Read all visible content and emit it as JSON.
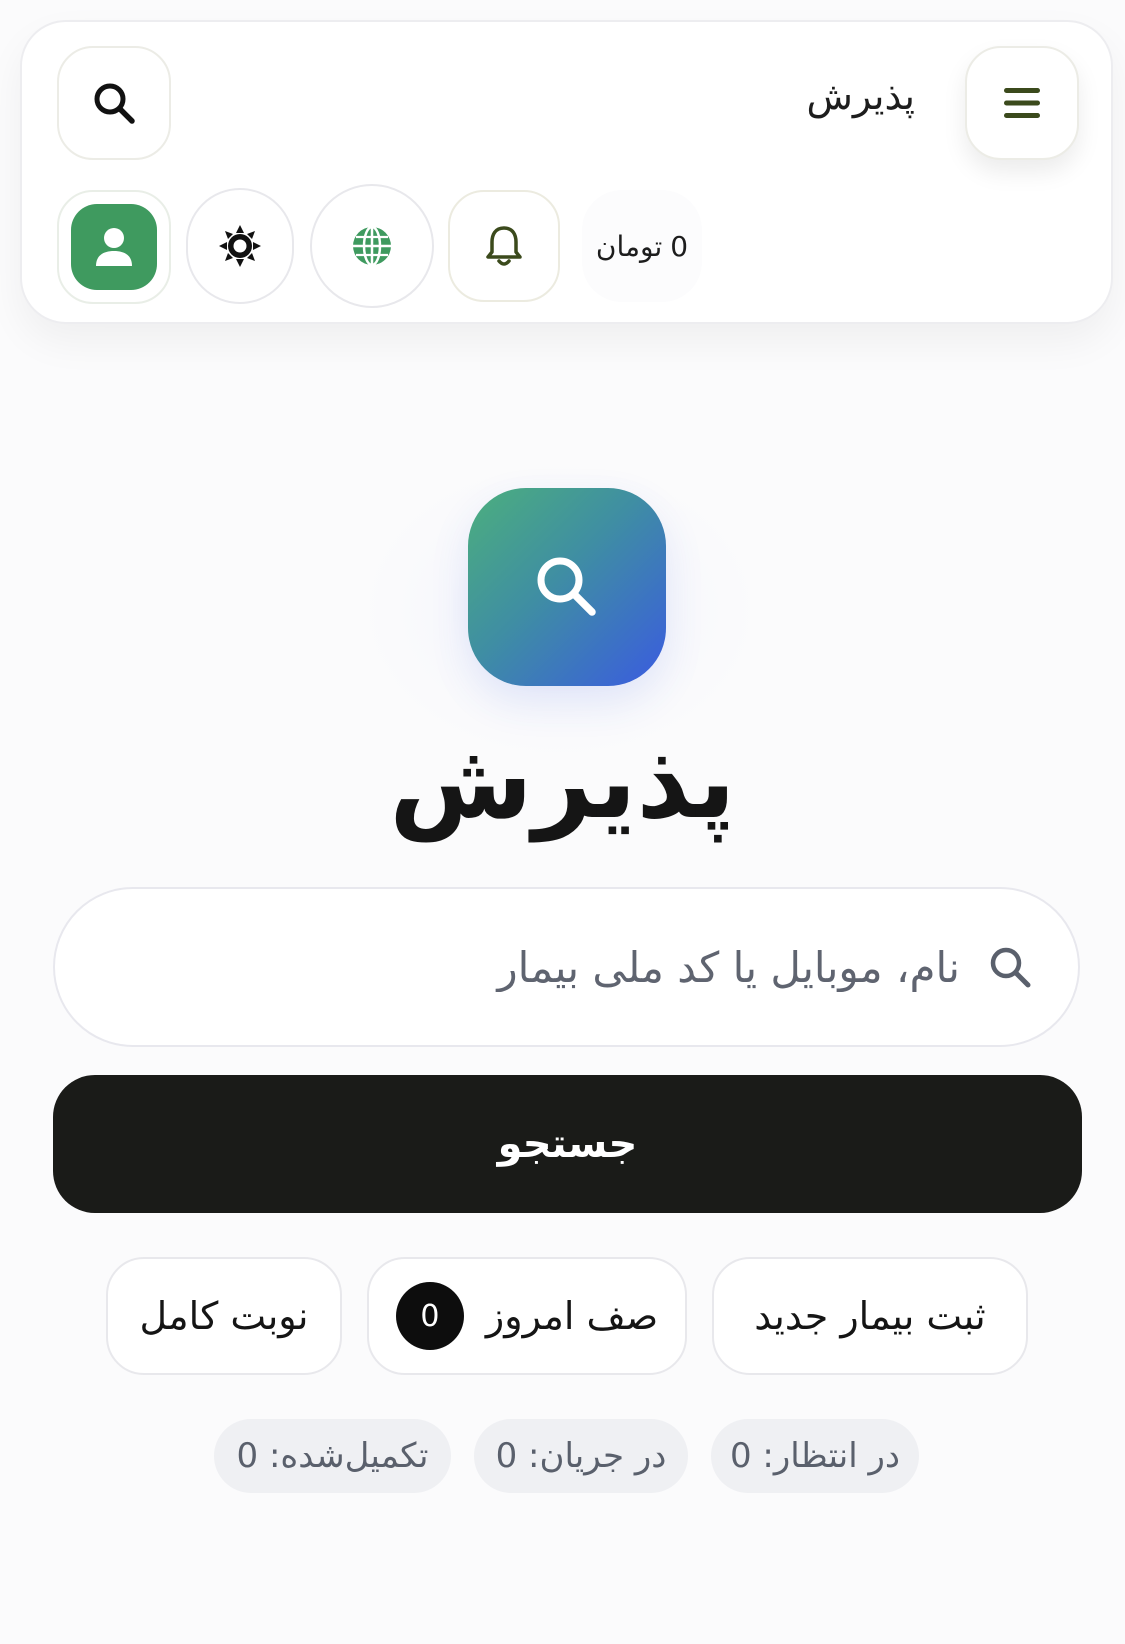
{
  "header": {
    "title": "پذیرش",
    "balance": {
      "amount": "0",
      "currency": "تومان"
    },
    "icons": {
      "menu": "hamburger-icon",
      "search": "search-icon",
      "notifications": "bell-icon",
      "language": "globe-icon",
      "theme": "sun-icon",
      "profile": "user-icon"
    }
  },
  "hero": {
    "title": "پذیرش",
    "icon": "search-icon"
  },
  "search": {
    "placeholder": "نام، موبایل یا کد ملی بیمار",
    "value": "",
    "submit_label": "جستجو"
  },
  "actions": {
    "new_patient": "ثبت بیمار جدید",
    "today_queue": "صف امروز",
    "today_queue_count": "0",
    "full_appointment": "نوبت کامل"
  },
  "stats": {
    "waiting": "در انتظار: 0",
    "in_progress": "در جریان: 0",
    "completed": "تکمیل‌شده: 0"
  },
  "colors": {
    "accent_green": "#3f9a5f",
    "hero_gradient_start": "#4caf7d",
    "hero_gradient_end": "#3a5be0",
    "primary_button": "#1a1b18",
    "icon_olive": "#3b4a1c",
    "chip_bg": "#eff0f3"
  }
}
